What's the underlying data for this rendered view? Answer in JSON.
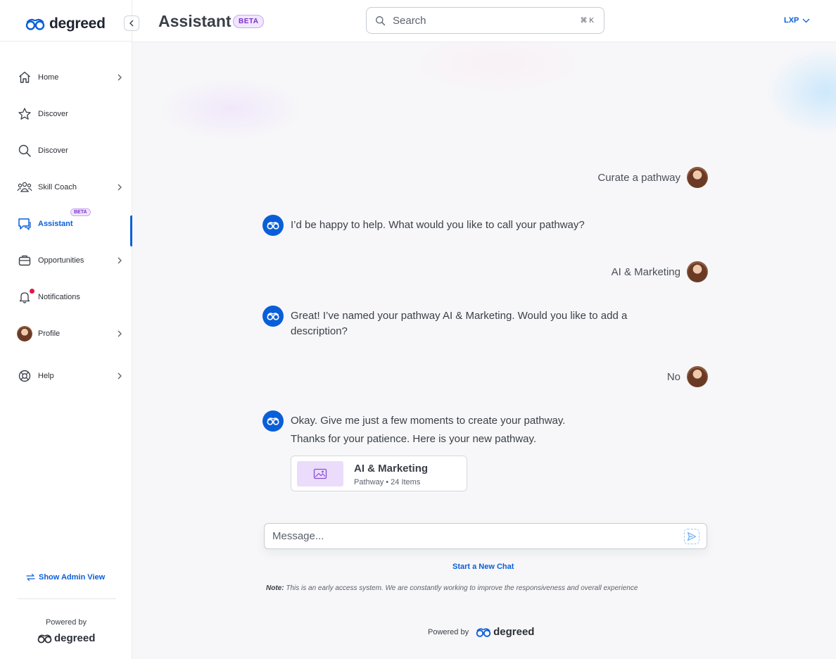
{
  "brand": {
    "name": "degreed",
    "color": "#0a5fd8"
  },
  "header": {
    "title": "Assistant",
    "badge": "BETA",
    "search_placeholder": "Search",
    "search_shortcut": "⌘ K",
    "workspace": "LXP"
  },
  "sidebar": {
    "items": [
      {
        "label": "Home",
        "icon": "home-icon",
        "has_chevron": true
      },
      {
        "label": "Discover",
        "icon": "star-icon",
        "has_chevron": false
      },
      {
        "label": "Discover",
        "icon": "search-icon",
        "has_chevron": false
      },
      {
        "label": "Skill Coach",
        "icon": "people-icon",
        "has_chevron": true
      },
      {
        "label": "Assistant",
        "icon": "chat-icon",
        "has_chevron": false,
        "active": true,
        "badge": "BETA"
      },
      {
        "label": "Opportunities",
        "icon": "briefcase-icon",
        "has_chevron": true
      },
      {
        "label": "Notifications",
        "icon": "bell-icon",
        "has_chevron": false,
        "has_dot": true
      },
      {
        "label": "Profile",
        "icon": "avatar",
        "has_chevron": true
      },
      {
        "label": "Help",
        "icon": "lifebuoy-icon",
        "has_chevron": true
      }
    ],
    "admin_view": "Show Admin View",
    "powered_by": "Powered by",
    "powered_logo": "degreed"
  },
  "chat": {
    "messages": [
      {
        "role": "user",
        "text": "Curate a pathway"
      },
      {
        "role": "assistant",
        "lines": [
          "I’d be happy to help. What would you like to call your pathway?"
        ]
      },
      {
        "role": "user",
        "text": "AI & Marketing"
      },
      {
        "role": "assistant",
        "lines": [
          "Great! I’ve named your pathway AI & Marketing. Would you like to add a description?"
        ]
      },
      {
        "role": "user",
        "text": "No"
      },
      {
        "role": "assistant",
        "lines": [
          "Okay. Give me just a few moments to create your pathway.",
          "Thanks for your patience. Here is your new pathway."
        ]
      }
    ],
    "pathway_card": {
      "title": "AI & Marketing",
      "meta": "Pathway • 24 Items"
    },
    "composer_placeholder": "Message...",
    "new_chat": "Start a New Chat",
    "note_label": "Note:",
    "note_text": " This is an early access system. We are constantly working to improve the responsiveness and overall experience",
    "powered_by": "Powered by",
    "powered_logo": "degreed"
  }
}
